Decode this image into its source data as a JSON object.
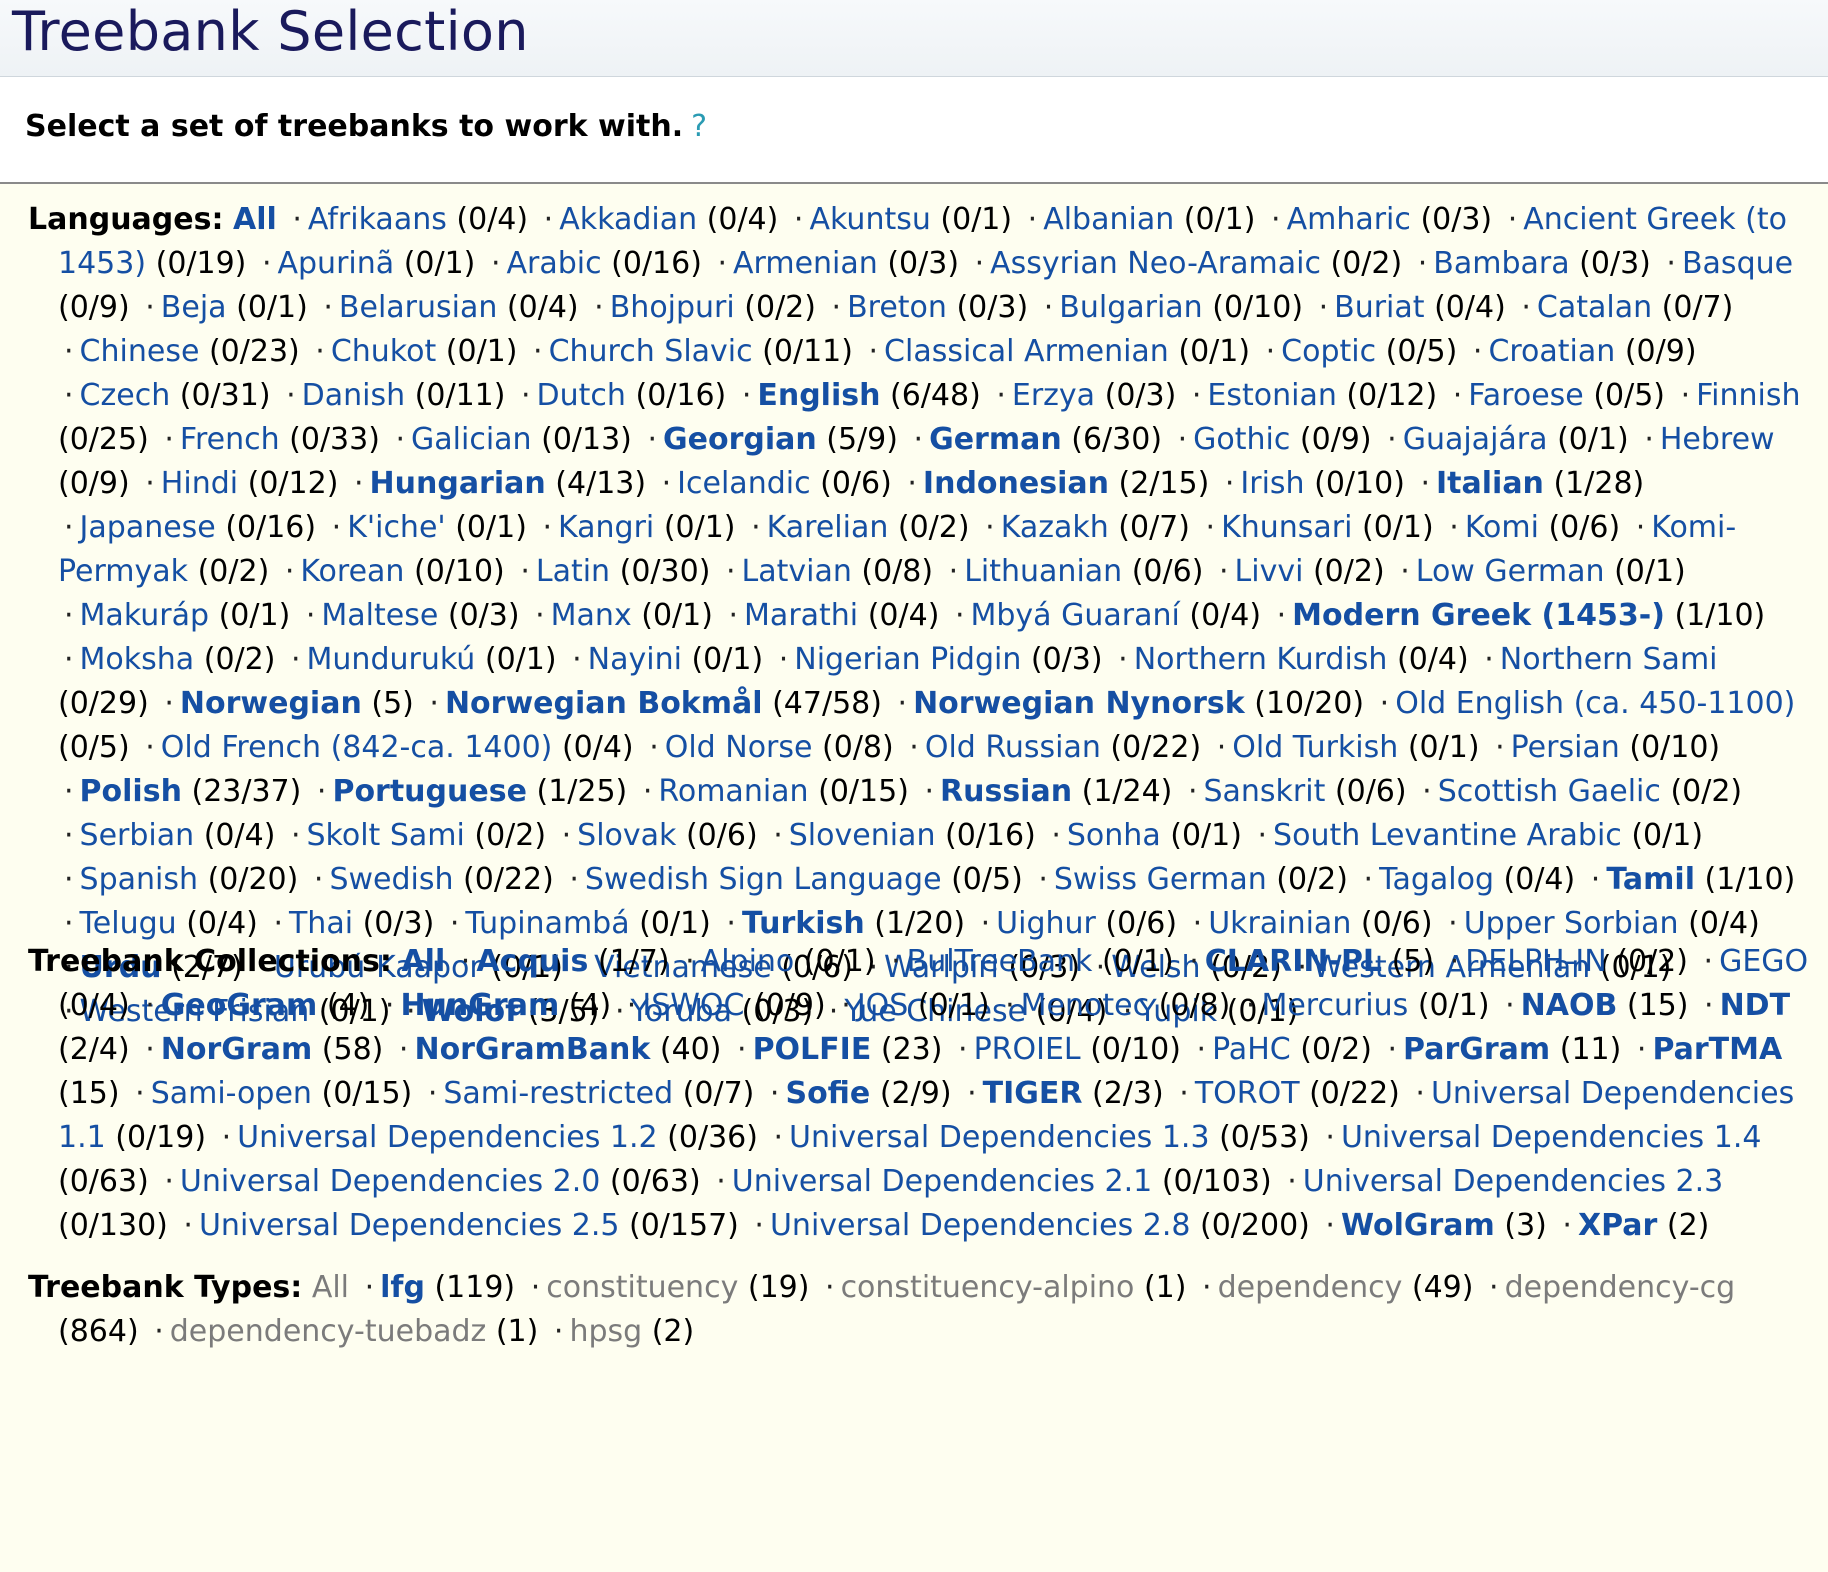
{
  "page": {
    "title": "Treebank Selection",
    "intro": "Select a set of treebanks to work with.",
    "help": "?"
  },
  "languages": {
    "label": "Languages:",
    "all": "All",
    "items": [
      {
        "name": "Afrikaans",
        "count": "(0/4)"
      },
      {
        "name": "Akkadian",
        "count": "(0/4)"
      },
      {
        "name": "Akuntsu",
        "count": "(0/1)"
      },
      {
        "name": "Albanian",
        "count": "(0/1)"
      },
      {
        "name": "Amharic",
        "count": "(0/3)"
      },
      {
        "name": "Ancient Greek (to 1453)",
        "count": "(0/19)"
      },
      {
        "name": "Apurinã",
        "count": "(0/1)"
      },
      {
        "name": "Arabic",
        "count": "(0/16)"
      },
      {
        "name": "Armenian",
        "count": "(0/3)"
      },
      {
        "name": "Assyrian Neo-Aramaic",
        "count": "(0/2)"
      },
      {
        "name": "Bambara",
        "count": "(0/3)"
      },
      {
        "name": "Basque",
        "count": "(0/9)"
      },
      {
        "name": "Beja",
        "count": "(0/1)"
      },
      {
        "name": "Belarusian",
        "count": "(0/4)"
      },
      {
        "name": "Bhojpuri",
        "count": "(0/2)"
      },
      {
        "name": "Breton",
        "count": "(0/3)"
      },
      {
        "name": "Bulgarian",
        "count": "(0/10)"
      },
      {
        "name": "Buriat",
        "count": "(0/4)"
      },
      {
        "name": "Catalan",
        "count": "(0/7)"
      },
      {
        "name": "Chinese",
        "count": "(0/23)"
      },
      {
        "name": "Chukot",
        "count": "(0/1)"
      },
      {
        "name": "Church Slavic",
        "count": "(0/11)"
      },
      {
        "name": "Classical Armenian",
        "count": "(0/1)"
      },
      {
        "name": "Coptic",
        "count": "(0/5)"
      },
      {
        "name": "Croatian",
        "count": "(0/9)"
      },
      {
        "name": "Czech",
        "count": "(0/31)"
      },
      {
        "name": "Danish",
        "count": "(0/11)"
      },
      {
        "name": "Dutch",
        "count": "(0/16)"
      },
      {
        "name": "English",
        "count": "(6/48)",
        "selected": true
      },
      {
        "name": "Erzya",
        "count": "(0/3)"
      },
      {
        "name": "Estonian",
        "count": "(0/12)"
      },
      {
        "name": "Faroese",
        "count": "(0/5)"
      },
      {
        "name": "Finnish",
        "count": "(0/25)"
      },
      {
        "name": "French",
        "count": "(0/33)"
      },
      {
        "name": "Galician",
        "count": "(0/13)"
      },
      {
        "name": "Georgian",
        "count": "(5/9)",
        "selected": true
      },
      {
        "name": "German",
        "count": "(6/30)",
        "selected": true
      },
      {
        "name": "Gothic",
        "count": "(0/9)"
      },
      {
        "name": "Guajajára",
        "count": "(0/1)"
      },
      {
        "name": "Hebrew",
        "count": "(0/9)"
      },
      {
        "name": "Hindi",
        "count": "(0/12)"
      },
      {
        "name": "Hungarian",
        "count": "(4/13)",
        "selected": true
      },
      {
        "name": "Icelandic",
        "count": "(0/6)"
      },
      {
        "name": "Indonesian",
        "count": "(2/15)",
        "selected": true
      },
      {
        "name": "Irish",
        "count": "(0/10)"
      },
      {
        "name": "Italian",
        "count": "(1/28)",
        "selected": true
      },
      {
        "name": "Japanese",
        "count": "(0/16)"
      },
      {
        "name": "K'iche'",
        "count": "(0/1)"
      },
      {
        "name": "Kangri",
        "count": "(0/1)"
      },
      {
        "name": "Karelian",
        "count": "(0/2)"
      },
      {
        "name": "Kazakh",
        "count": "(0/7)"
      },
      {
        "name": "Khunsari",
        "count": "(0/1)"
      },
      {
        "name": "Komi",
        "count": "(0/6)"
      },
      {
        "name": "Komi-Permyak",
        "count": "(0/2)"
      },
      {
        "name": "Korean",
        "count": "(0/10)"
      },
      {
        "name": "Latin",
        "count": "(0/30)"
      },
      {
        "name": "Latvian",
        "count": "(0/8)"
      },
      {
        "name": "Lithuanian",
        "count": "(0/6)"
      },
      {
        "name": "Livvi",
        "count": "(0/2)"
      },
      {
        "name": "Low German",
        "count": "(0/1)"
      },
      {
        "name": "Makuráp",
        "count": "(0/1)"
      },
      {
        "name": "Maltese",
        "count": "(0/3)"
      },
      {
        "name": "Manx",
        "count": "(0/1)"
      },
      {
        "name": "Marathi",
        "count": "(0/4)"
      },
      {
        "name": "Mbyá Guaraní",
        "count": "(0/4)"
      },
      {
        "name": "Modern Greek (1453-)",
        "count": "(1/10)",
        "selected": true
      },
      {
        "name": "Moksha",
        "count": "(0/2)"
      },
      {
        "name": "Mundurukú",
        "count": "(0/1)"
      },
      {
        "name": "Nayini",
        "count": "(0/1)"
      },
      {
        "name": "Nigerian Pidgin",
        "count": "(0/3)"
      },
      {
        "name": "Northern Kurdish",
        "count": "(0/4)"
      },
      {
        "name": "Northern Sami",
        "count": "(0/29)"
      },
      {
        "name": "Norwegian",
        "count": "(5)",
        "selected": true
      },
      {
        "name": "Norwegian Bokmål",
        "count": "(47/58)",
        "selected": true
      },
      {
        "name": "Norwegian Nynorsk",
        "count": "(10/20)",
        "selected": true
      },
      {
        "name": "Old English (ca. 450-1100)",
        "count": "(0/5)"
      },
      {
        "name": "Old French (842-ca. 1400)",
        "count": "(0/4)"
      },
      {
        "name": "Old Norse",
        "count": "(0/8)"
      },
      {
        "name": "Old Russian",
        "count": "(0/22)"
      },
      {
        "name": "Old Turkish",
        "count": "(0/1)"
      },
      {
        "name": "Persian",
        "count": "(0/10)"
      },
      {
        "name": "Polish",
        "count": "(23/37)",
        "selected": true
      },
      {
        "name": "Portuguese",
        "count": "(1/25)",
        "selected": true
      },
      {
        "name": "Romanian",
        "count": "(0/15)"
      },
      {
        "name": "Russian",
        "count": "(1/24)",
        "selected": true
      },
      {
        "name": "Sanskrit",
        "count": "(0/6)"
      },
      {
        "name": "Scottish Gaelic",
        "count": "(0/2)"
      },
      {
        "name": "Serbian",
        "count": "(0/4)"
      },
      {
        "name": "Skolt Sami",
        "count": "(0/2)"
      },
      {
        "name": "Slovak",
        "count": "(0/6)"
      },
      {
        "name": "Slovenian",
        "count": "(0/16)"
      },
      {
        "name": "Sonha",
        "count": "(0/1)"
      },
      {
        "name": "South Levantine Arabic",
        "count": "(0/1)"
      },
      {
        "name": "Spanish",
        "count": "(0/20)"
      },
      {
        "name": "Swedish",
        "count": "(0/22)"
      },
      {
        "name": "Swedish Sign Language",
        "count": "(0/5)"
      },
      {
        "name": "Swiss German",
        "count": "(0/2)"
      },
      {
        "name": "Tagalog",
        "count": "(0/4)"
      },
      {
        "name": "Tamil",
        "count": "(1/10)",
        "selected": true
      },
      {
        "name": "Telugu",
        "count": "(0/4)"
      },
      {
        "name": "Thai",
        "count": "(0/3)"
      },
      {
        "name": "Tupinambá",
        "count": "(0/1)"
      },
      {
        "name": "Turkish",
        "count": "(1/20)",
        "selected": true
      },
      {
        "name": "Uighur",
        "count": "(0/6)"
      },
      {
        "name": "Ukrainian",
        "count": "(0/6)"
      },
      {
        "name": "Upper Sorbian",
        "count": "(0/4)"
      },
      {
        "name": "Urdu",
        "count": "(2/7)",
        "selected": true
      },
      {
        "name": "Urubú-Kaapor",
        "count": "(0/1)"
      },
      {
        "name": "Vietnamese",
        "count": "(0/6)"
      },
      {
        "name": "Warlpiri",
        "count": "(0/3)"
      },
      {
        "name": "Welsh",
        "count": "(0/2)"
      },
      {
        "name": "Western Armenian",
        "count": "(0/1)"
      },
      {
        "name": "Western Frisian",
        "count": "(0/1)"
      },
      {
        "name": "Wolof",
        "count": "(3/5)",
        "selected": true
      },
      {
        "name": "Yoruba",
        "count": "(0/3)"
      },
      {
        "name": "Yue Chinese",
        "count": "(0/4)"
      },
      {
        "name": "Yupik",
        "count": "(0/1)"
      }
    ]
  },
  "collections": {
    "label": "Treebank Collections:",
    "all": "All",
    "items": [
      {
        "name": "Acquis",
        "count": "(1/7)",
        "selected": true
      },
      {
        "name": "Alpino",
        "count": "(0/1)"
      },
      {
        "name": "BulTreeBank",
        "count": "(0/1)"
      },
      {
        "name": "CLARIN-PL",
        "count": "(5)",
        "selected": true
      },
      {
        "name": "DELPH-IN",
        "count": "(0/2)"
      },
      {
        "name": "GEGO",
        "count": "(0/4)"
      },
      {
        "name": "GeoGram",
        "count": "(4)",
        "selected": true
      },
      {
        "name": "HunGram",
        "count": "(4)",
        "selected": true
      },
      {
        "name": "ISWOC",
        "count": "(0/9)"
      },
      {
        "name": "JOS",
        "count": "(0/1)"
      },
      {
        "name": "Menotec",
        "count": "(0/8)"
      },
      {
        "name": "Mercurius",
        "count": "(0/1)"
      },
      {
        "name": "NAOB",
        "count": "(15)",
        "selected": true
      },
      {
        "name": "NDT",
        "count": "(2/4)",
        "selected": true
      },
      {
        "name": "NorGram",
        "count": "(58)",
        "selected": true
      },
      {
        "name": "NorGramBank",
        "count": "(40)",
        "selected": true
      },
      {
        "name": "POLFIE",
        "count": "(23)",
        "selected": true
      },
      {
        "name": "PROIEL",
        "count": "(0/10)"
      },
      {
        "name": "PaHC",
        "count": "(0/2)"
      },
      {
        "name": "ParGram",
        "count": "(11)",
        "selected": true
      },
      {
        "name": "ParTMA",
        "count": "(15)",
        "selected": true
      },
      {
        "name": "Sami-open",
        "count": "(0/15)"
      },
      {
        "name": "Sami-restricted",
        "count": "(0/7)"
      },
      {
        "name": "Sofie",
        "count": "(2/9)",
        "selected": true
      },
      {
        "name": "TIGER",
        "count": "(2/3)",
        "selected": true
      },
      {
        "name": "TOROT",
        "count": "(0/22)"
      },
      {
        "name": "Universal Dependencies 1.1",
        "count": "(0/19)"
      },
      {
        "name": "Universal Dependencies 1.2",
        "count": "(0/36)"
      },
      {
        "name": "Universal Dependencies 1.3",
        "count": "(0/53)"
      },
      {
        "name": "Universal Dependencies 1.4",
        "count": "(0/63)"
      },
      {
        "name": "Universal Dependencies 2.0",
        "count": "(0/63)"
      },
      {
        "name": "Universal Dependencies 2.1",
        "count": "(0/103)"
      },
      {
        "name": "Universal Dependencies 2.3",
        "count": "(0/130)"
      },
      {
        "name": "Universal Dependencies 2.5",
        "count": "(0/157)"
      },
      {
        "name": "Universal Dependencies 2.8",
        "count": "(0/200)"
      },
      {
        "name": "WolGram",
        "count": "(3)",
        "selected": true
      },
      {
        "name": "XPar",
        "count": "(2)",
        "selected": true
      }
    ]
  },
  "types": {
    "label": "Treebank Types:",
    "all": "All",
    "items": [
      {
        "name": "lfg",
        "count": "(119)",
        "selected": true
      },
      {
        "name": "constituency",
        "count": "(19)"
      },
      {
        "name": "constituency-alpino",
        "count": "(1)"
      },
      {
        "name": "dependency",
        "count": "(49)"
      },
      {
        "name": "dependency-cg",
        "count": "(864)"
      },
      {
        "name": "dependency-tuebadz",
        "count": "(1)"
      },
      {
        "name": "hpsg",
        "count": "(2)"
      }
    ]
  },
  "colors": {
    "link": "#154fa3",
    "muted_link": "#7b7b7b",
    "title": "#1a1a5c",
    "help": "#2a9bb3",
    "background": "#fefef0"
  }
}
